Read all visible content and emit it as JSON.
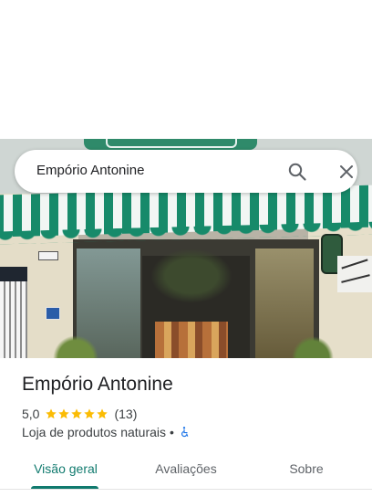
{
  "search": {
    "query": "Empório Antonine",
    "search_icon": "search-icon",
    "close_icon": "close-icon"
  },
  "place": {
    "name": "Empório Antonine",
    "rating": "5,0",
    "stars": 5,
    "review_count": "(13)",
    "category": "Loja de produtos naturais",
    "separator": "•",
    "accessibility_icon": "wheelchair-icon"
  },
  "tabs": [
    {
      "label": "Visão geral",
      "active": true
    },
    {
      "label": "Avaliações",
      "active": false
    },
    {
      "label": "Sobre",
      "active": false
    }
  ],
  "colors": {
    "accent": "#107a6e",
    "star": "#fbbc04",
    "accessibility": "#1a73e8"
  }
}
